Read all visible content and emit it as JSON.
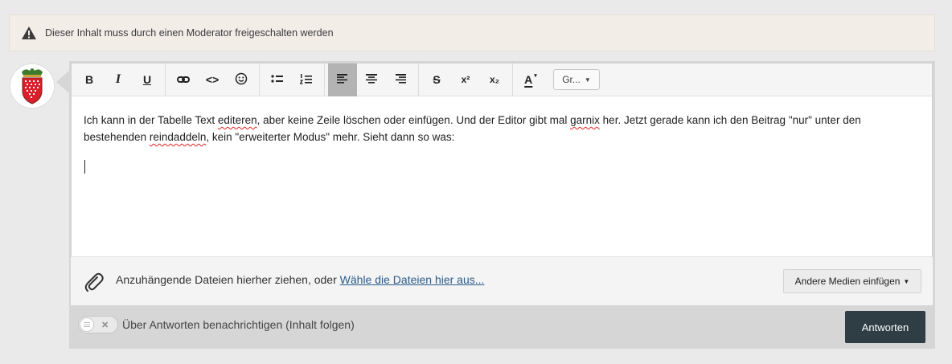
{
  "notice": {
    "icon": "warning-icon",
    "text": "Dieser Inhalt muss durch einen Moderator freigeschalten werden"
  },
  "toolbar": {
    "buttons": [
      {
        "name": "bold",
        "label": "B"
      },
      {
        "name": "italic",
        "label": "I"
      },
      {
        "name": "underline",
        "label": "U"
      },
      {
        "name": "link",
        "icon": "link-icon"
      },
      {
        "name": "code",
        "label": "<>"
      },
      {
        "name": "emoji",
        "icon": "smiley-icon"
      },
      {
        "name": "bullet-list",
        "icon": "bullet-list-icon"
      },
      {
        "name": "numbered-list",
        "icon": "numbered-list-icon"
      },
      {
        "name": "align-left",
        "icon": "align-left-icon",
        "active": true
      },
      {
        "name": "align-center",
        "icon": "align-center-icon"
      },
      {
        "name": "align-right",
        "icon": "align-right-icon"
      },
      {
        "name": "strikethrough",
        "label": "S"
      },
      {
        "name": "superscript",
        "label": "x²"
      },
      {
        "name": "subscript",
        "label": "x₂"
      },
      {
        "name": "text-color",
        "label": "A"
      }
    ],
    "font_size_select": "Gr..."
  },
  "content": {
    "p1_a": "Ich kann in der Tabelle Text ",
    "p1_sp1": "editeren",
    "p1_b": ", aber keine Zeile löschen oder einfügen. Und der Editor gibt mal ",
    "p1_sp2": "garnix",
    "p1_c": " her. Jetzt gerade kann ich den Beitrag \"nur\" unter den bestehenden ",
    "p1_sp3": "reindaddeln",
    "p1_d": ", kein \"erweiterter Modus\" mehr. Sieht dann so was:"
  },
  "attachments": {
    "drop_text": "Anzuhängende Dateien hierher ziehen, oder ",
    "choose_link": "Wähle die Dateien hier aus...",
    "media_button": "Andere Medien einfügen"
  },
  "footer": {
    "notify_label": "Über Antworten benachrichtigen (Inhalt folgen)",
    "reply_button": "Antworten"
  },
  "colors": {
    "reply_button_bg": "#2f3d45",
    "notice_bg": "#f3ede8",
    "link": "#2b5b8a",
    "active_tool": "#b3b3b3"
  }
}
